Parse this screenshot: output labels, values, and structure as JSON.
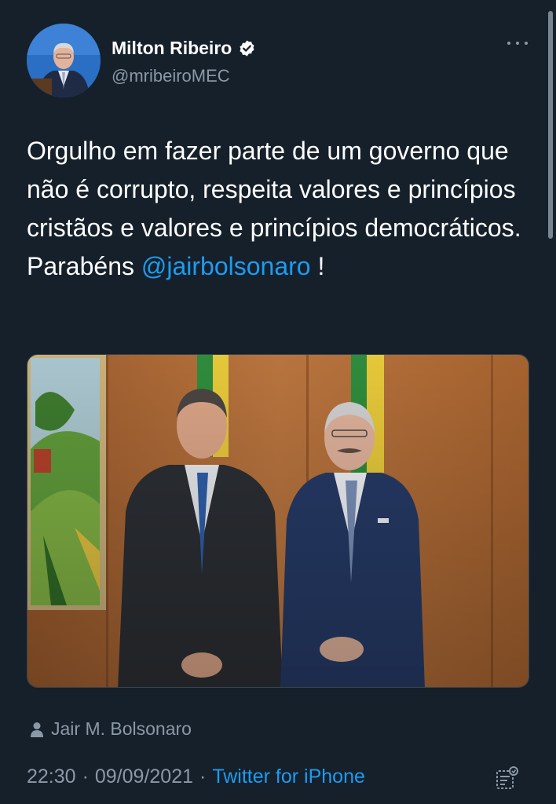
{
  "author": {
    "display_name": "Milton Ribeiro",
    "handle": "@mribeiroMEC",
    "verified": true
  },
  "tweet": {
    "text": "Orgulho em fazer parte de um governo que não é corrupto, respeita valores e princípios cristãos e valores e princípios democráticos. Parabéns ",
    "mention": "@jairbolsonaro",
    "text_end": " !"
  },
  "tagged_user": "Jair M. Bolsonaro",
  "meta": {
    "time": "22:30",
    "separator": "·",
    "date": "09/09/2021",
    "source": "Twitter for iPhone"
  },
  "icons": {
    "more": "more-dots-icon",
    "verified": "verified-badge-icon",
    "tagged": "person-icon",
    "analytics": "analytics-icon"
  },
  "colors": {
    "background": "#15202b",
    "link": "#1d9bf0",
    "secondary_text": "#8b98a5"
  }
}
